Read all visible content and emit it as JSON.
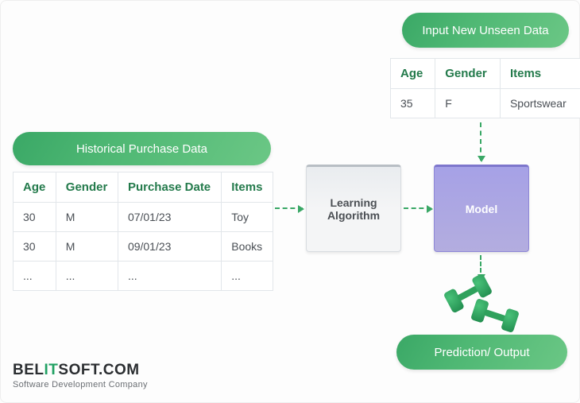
{
  "input_new": {
    "pill": "Input New Unseen Data",
    "headers": [
      "Age",
      "Gender",
      "Items"
    ],
    "row": [
      "35",
      "F",
      "Sportswear"
    ]
  },
  "historical": {
    "pill": "Historical Purchase Data",
    "headers": [
      "Age",
      "Gender",
      "Purchase Date",
      "Items"
    ],
    "rows": [
      [
        "30",
        "M",
        "07/01/23",
        "Toy"
      ],
      [
        "30",
        "M",
        "09/01/23",
        "Books"
      ],
      [
        "...",
        "...",
        "...",
        "..."
      ]
    ]
  },
  "algo_label": "Learning Algorithm",
  "model_label": "Model",
  "prediction_pill": "Prediction/ Output",
  "logo": {
    "pre": "BEL",
    "it": "IT",
    "post": "SOFT.COM",
    "sub": "Software Development Company"
  },
  "colors": {
    "green": "#3aa866",
    "purple": "#a6a1e6",
    "grey": "#e9ecef"
  }
}
